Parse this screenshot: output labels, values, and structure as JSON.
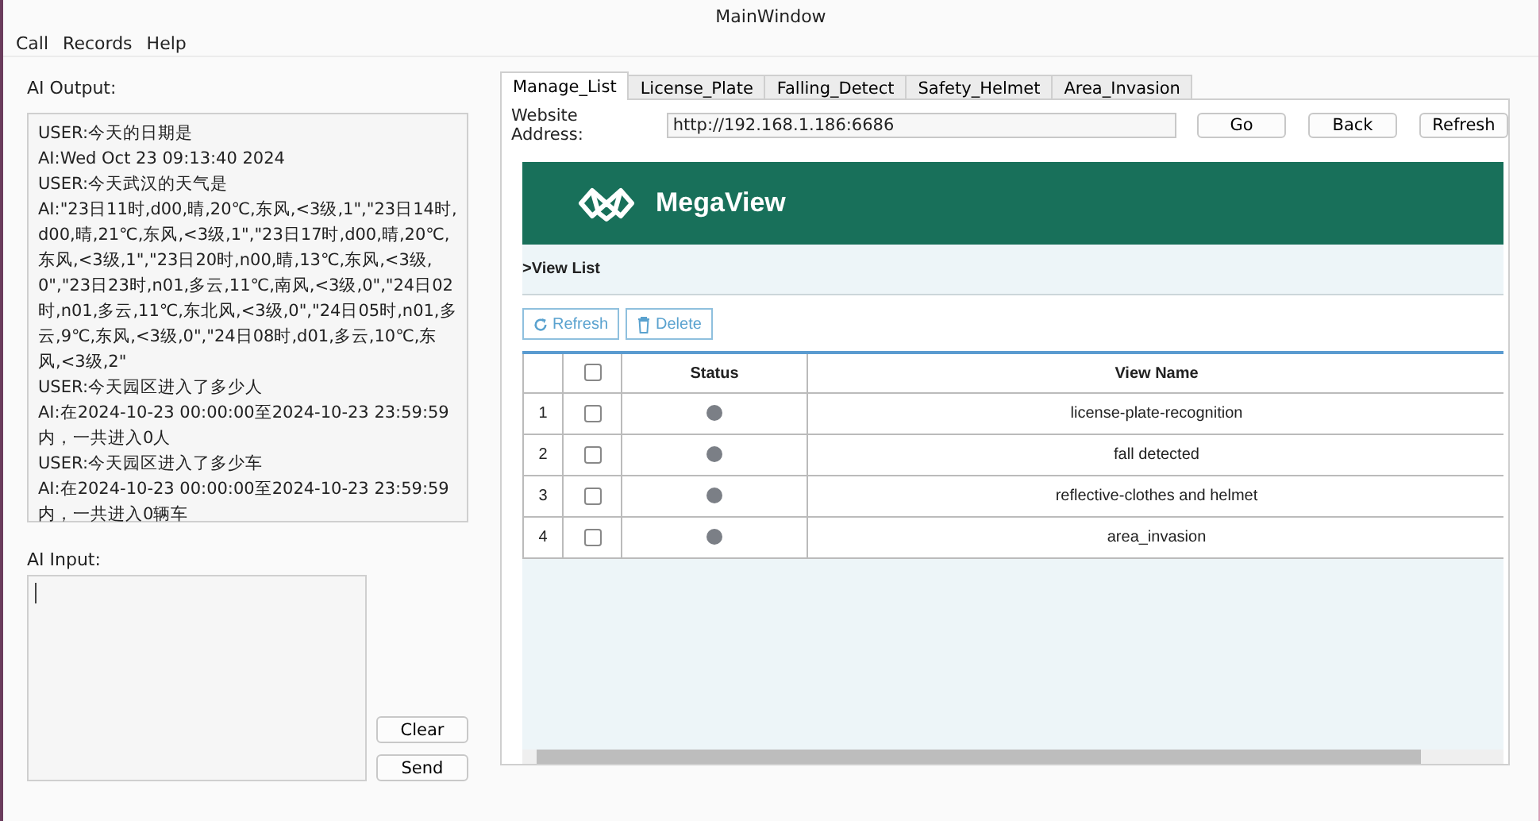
{
  "window": {
    "title": "MainWindow"
  },
  "menu": [
    "Call",
    "Records",
    "Help"
  ],
  "output": {
    "label": "AI Output:",
    "lines": [
      "USER:今天的日期是",
      "AI:Wed Oct 23 09:13:40 2024",
      "USER:今天武汉的天气是",
      "AI:\"23日11时,d00,晴,20℃,东风,<3级,1\",\"23日14时,d00,晴,21℃,东风,<3级,1\",\"23日17时,d00,晴,20℃,东风,<3级,1\",\"23日20时,n00,晴,13℃,东风,<3级,0\",\"23日23时,n01,多云,11℃,南风,<3级,0\",\"24日02时,n01,多云,11℃,东北风,<3级,0\",\"24日05时,n01,多云,9℃,东风,<3级,0\",\"24日08时,d01,多云,10℃,东风,<3级,2\"",
      "USER:今天园区进入了多少人",
      "AI:在2024-10-23 00:00:00至2024-10-23 23:59:59内，一共进入0人",
      "USER:今天园区进入了多少车",
      "AI:在2024-10-23 00:00:00至2024-10-23 23:59:59内，一共进入0辆车"
    ]
  },
  "input": {
    "label": "AI Input:",
    "buttons": [
      "Clear",
      "Send"
    ]
  },
  "tabs": [
    {
      "label": "Manage_List",
      "selected": true
    },
    {
      "label": "License_Plate",
      "selected": false
    },
    {
      "label": "Falling_Detect",
      "selected": false
    },
    {
      "label": "Safety_Helmet",
      "selected": false
    },
    {
      "label": "Area_Invasion",
      "selected": false
    }
  ],
  "address": {
    "label": "Website Address:",
    "value": "http://192.168.1.186:6686",
    "buttons": [
      "Go",
      "Back",
      "Refresh"
    ]
  },
  "web": {
    "brand": "MegaView",
    "breadcrumb": ">View List",
    "actions": [
      "Refresh",
      "Delete"
    ],
    "columns": [
      "Status",
      "View Name"
    ],
    "header_checked": false,
    "rows": [
      {
        "index": "1",
        "checked": false,
        "name": "license-plate-recognition"
      },
      {
        "index": "2",
        "checked": false,
        "name": "fall detected"
      },
      {
        "index": "3",
        "checked": false,
        "name": "reflective-clothes and helmet"
      },
      {
        "index": "4",
        "checked": false,
        "name": "area_invasion"
      }
    ]
  }
}
